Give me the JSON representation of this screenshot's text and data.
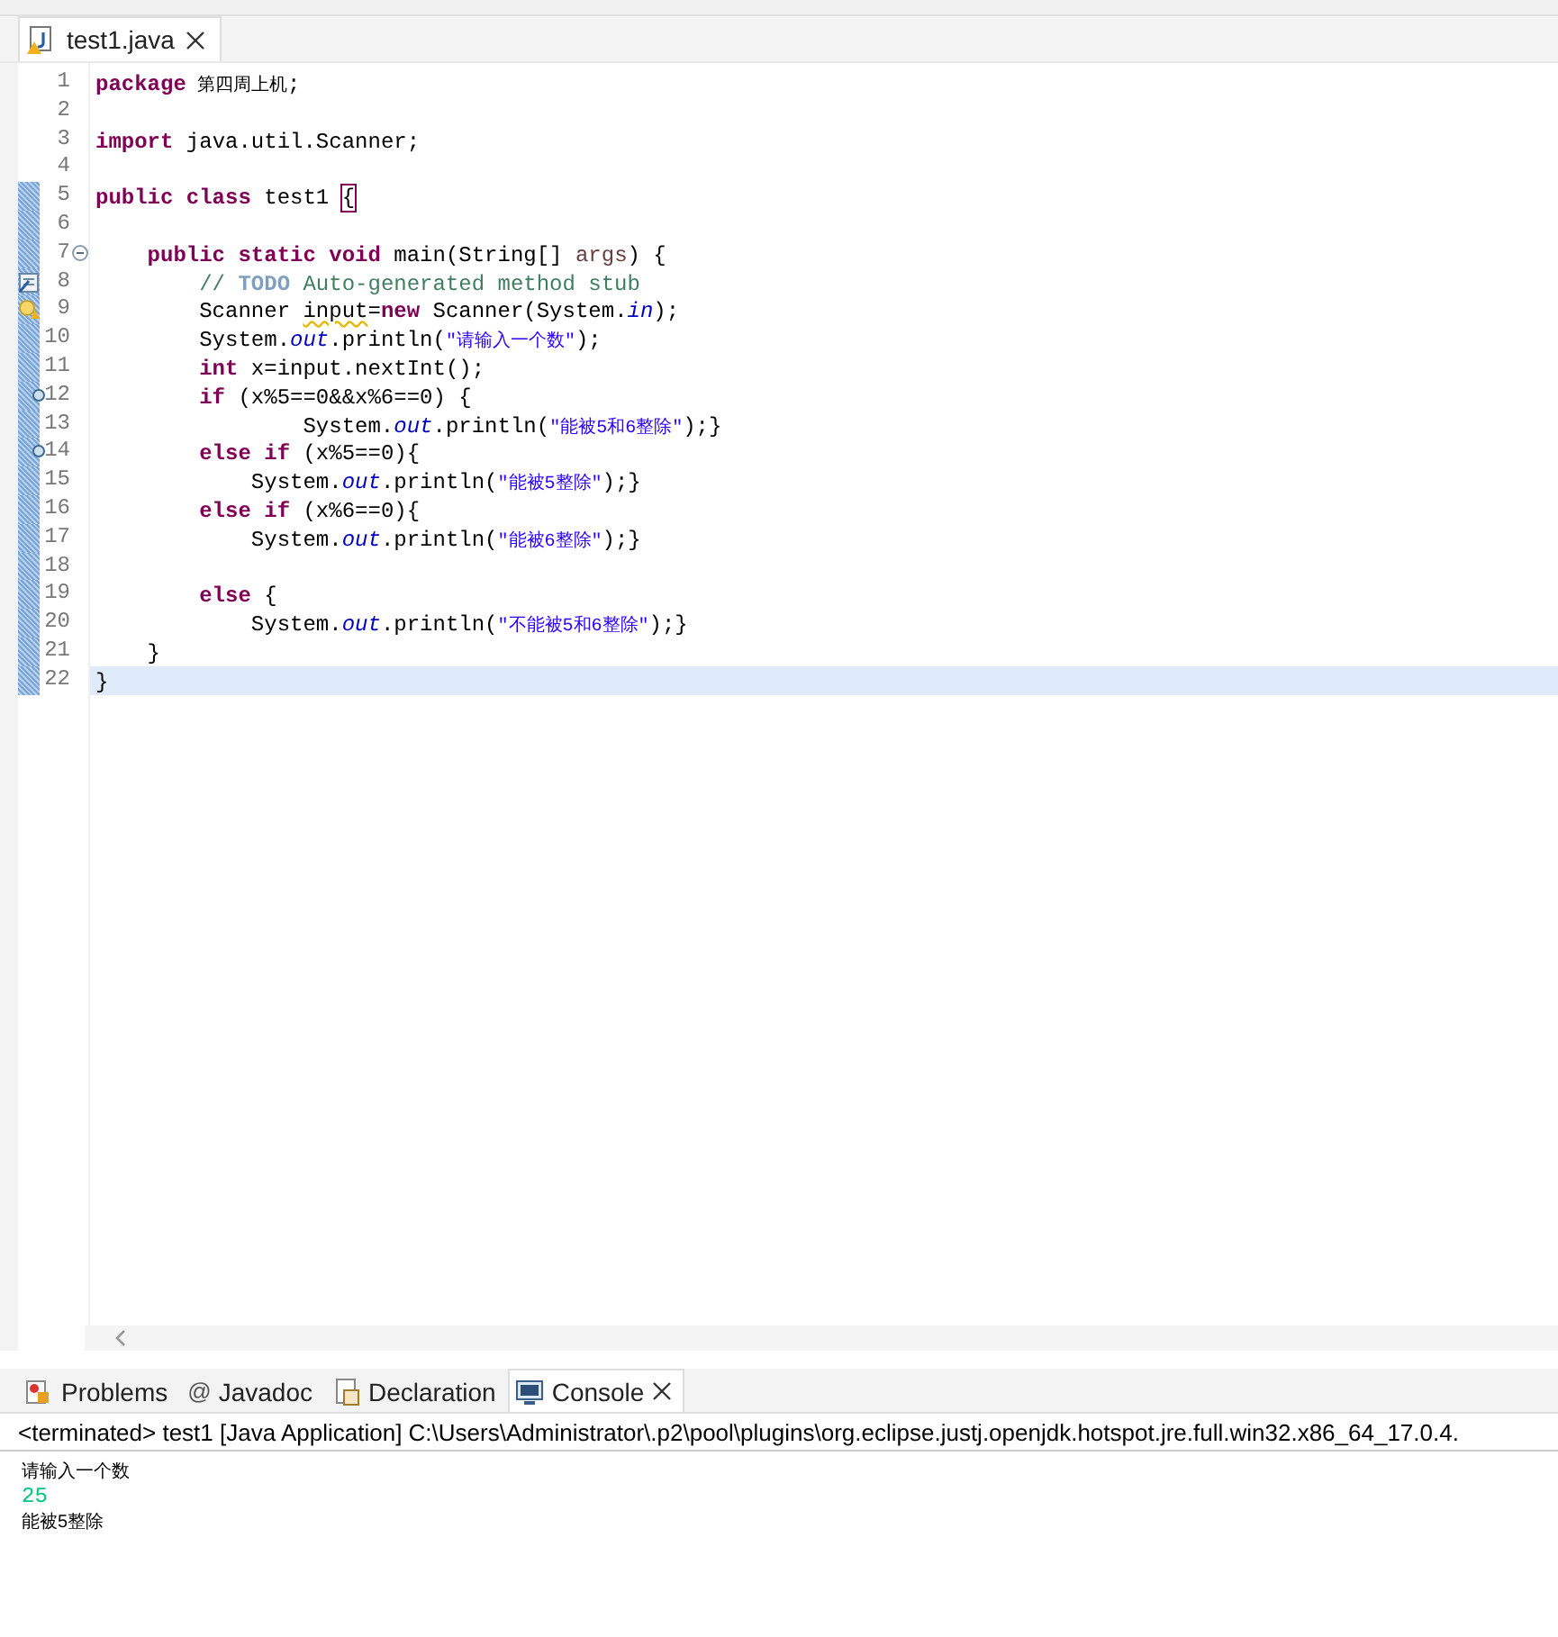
{
  "editor_tab": {
    "label": "test1.java",
    "selected": true
  },
  "code_lines": [
    {
      "kind": "plain",
      "number": "1",
      "in_range": false,
      "current": false,
      "tokens": [
        {
          "kind": "keyword",
          "text": "package"
        },
        {
          "kind": "cjk",
          "text": " 第四周上机"
        },
        {
          "kind": "plain",
          "text": ";"
        }
      ]
    },
    {
      "kind": "plain",
      "number": "2",
      "in_range": false,
      "current": false
    },
    {
      "kind": "plain",
      "number": "3",
      "in_range": false,
      "current": false,
      "tokens": [
        {
          "kind": "keyword",
          "text": "import"
        },
        {
          "kind": "plain",
          "text": " java.util.Scanner;"
        }
      ]
    },
    {
      "kind": "plain",
      "number": "4",
      "in_range": false,
      "current": false
    },
    {
      "kind": "plain",
      "number": "5",
      "in_range": true,
      "current": false,
      "tokens": [
        {
          "kind": "keyword",
          "text": "public class"
        },
        {
          "kind": "plain",
          "text": " test1 "
        },
        {
          "kind": "bracket",
          "text": "{"
        }
      ]
    },
    {
      "kind": "plain",
      "number": "6",
      "in_range": true,
      "current": false
    },
    {
      "kind": "fold",
      "number": "7",
      "in_range": true,
      "current": false,
      "tokens": [
        {
          "kind": "keyword",
          "text": "    public static void"
        },
        {
          "kind": "plain",
          "text": " main(String[] "
        },
        {
          "kind": "param",
          "text": "args"
        },
        {
          "kind": "plain",
          "text": ") {"
        }
      ]
    },
    {
      "kind": "task",
      "number": "8",
      "in_range": true,
      "current": false,
      "tokens": [
        {
          "kind": "comment",
          "text": "        // "
        },
        {
          "kind": "todo",
          "text": "TODO"
        },
        {
          "kind": "comment",
          "text": " Auto-generated method stub"
        }
      ]
    },
    {
      "kind": "warning",
      "number": "9",
      "in_range": true,
      "current": false,
      "tokens": [
        {
          "kind": "plain",
          "text": "        Scanner "
        },
        {
          "kind": "warning",
          "text": "input"
        },
        {
          "kind": "plain",
          "text": "="
        },
        {
          "kind": "keyword",
          "text": "new"
        },
        {
          "kind": "plain",
          "text": " Scanner(System."
        },
        {
          "kind": "field",
          "text": "in"
        },
        {
          "kind": "plain",
          "text": ");"
        }
      ]
    },
    {
      "kind": "plain",
      "number": "10",
      "in_range": true,
      "current": false,
      "tokens": [
        {
          "kind": "plain",
          "text": "        System."
        },
        {
          "kind": "field",
          "text": "out"
        },
        {
          "kind": "plain",
          "text": ".println("
        },
        {
          "kind": "string",
          "text": "\"请输入一个数\""
        },
        {
          "kind": "plain",
          "text": ");"
        }
      ]
    },
    {
      "kind": "plain",
      "number": "11",
      "in_range": true,
      "current": false,
      "tokens": [
        {
          "kind": "keyword",
          "text": "        int"
        },
        {
          "kind": "plain",
          "text": " x=input.nextInt();"
        }
      ]
    },
    {
      "kind": "occurrence",
      "number": "12",
      "in_range": true,
      "current": false,
      "tokens": [
        {
          "kind": "keyword",
          "text": "        if"
        },
        {
          "kind": "plain",
          "text": " (x%5==0&&x%6==0) {"
        }
      ]
    },
    {
      "kind": "plain",
      "number": "13",
      "in_range": true,
      "current": false,
      "tokens": [
        {
          "kind": "plain",
          "text": "                System."
        },
        {
          "kind": "field",
          "text": "out"
        },
        {
          "kind": "plain",
          "text": ".println("
        },
        {
          "kind": "string",
          "text": "\"能被5和6整除\""
        },
        {
          "kind": "plain",
          "text": ");}"
        }
      ]
    },
    {
      "kind": "occurrence",
      "number": "14",
      "in_range": true,
      "current": false,
      "tokens": [
        {
          "kind": "keyword",
          "text": "        else if"
        },
        {
          "kind": "plain",
          "text": " (x%5==0){"
        }
      ]
    },
    {
      "kind": "plain",
      "number": "15",
      "in_range": true,
      "current": false,
      "tokens": [
        {
          "kind": "plain",
          "text": "            System."
        },
        {
          "kind": "field",
          "text": "out"
        },
        {
          "kind": "plain",
          "text": ".println("
        },
        {
          "kind": "string",
          "text": "\"能被5整除\""
        },
        {
          "kind": "plain",
          "text": ");}"
        }
      ]
    },
    {
      "kind": "plain",
      "number": "16",
      "in_range": true,
      "current": false,
      "tokens": [
        {
          "kind": "keyword",
          "text": "        else if"
        },
        {
          "kind": "plain",
          "text": " (x%6==0){"
        }
      ]
    },
    {
      "kind": "plain",
      "number": "17",
      "in_range": true,
      "current": false,
      "tokens": [
        {
          "kind": "plain",
          "text": "            System."
        },
        {
          "kind": "field",
          "text": "out"
        },
        {
          "kind": "plain",
          "text": ".println("
        },
        {
          "kind": "string",
          "text": "\"能被6整除\""
        },
        {
          "kind": "plain",
          "text": ");}"
        }
      ]
    },
    {
      "kind": "plain",
      "number": "18",
      "in_range": true,
      "current": false
    },
    {
      "kind": "plain",
      "number": "19",
      "in_range": true,
      "current": false,
      "tokens": [
        {
          "kind": "keyword",
          "text": "        else"
        },
        {
          "kind": "plain",
          "text": " {"
        }
      ]
    },
    {
      "kind": "plain",
      "number": "20",
      "in_range": true,
      "current": false,
      "tokens": [
        {
          "kind": "plain",
          "text": "            System."
        },
        {
          "kind": "field",
          "text": "out"
        },
        {
          "kind": "plain",
          "text": ".println("
        },
        {
          "kind": "string",
          "text": "\"不能被5和6整除\""
        },
        {
          "kind": "plain",
          "text": ");}"
        }
      ]
    },
    {
      "kind": "plain",
      "number": "21",
      "in_range": true,
      "current": false,
      "tokens": [
        {
          "kind": "plain",
          "text": "    }"
        }
      ]
    },
    {
      "kind": "plain",
      "number": "22",
      "in_range": true,
      "current": true,
      "tokens": [
        {
          "kind": "plain",
          "text": "}"
        }
      ]
    }
  ],
  "view_tabs": [
    {
      "kind": "problems",
      "label": "Problems",
      "selected": false
    },
    {
      "kind": "javadoc",
      "glyph": "@",
      "label": "Javadoc",
      "selected": false
    },
    {
      "kind": "declaration",
      "label": "Declaration",
      "selected": false
    },
    {
      "kind": "console",
      "label": "Console",
      "selected": true
    }
  ],
  "console": {
    "header": "<terminated> test1 [Java Application] C:\\Users\\Administrator\\.p2\\pool\\plugins\\org.eclipse.justj.openjdk.hotspot.jre.full.win32.x86_64_17.0.4.",
    "lines": [
      {
        "kind": "output",
        "text": "请输入一个数"
      },
      {
        "kind": "input",
        "text": "25"
      },
      {
        "kind": "output",
        "text": "能被5整除"
      }
    ]
  }
}
